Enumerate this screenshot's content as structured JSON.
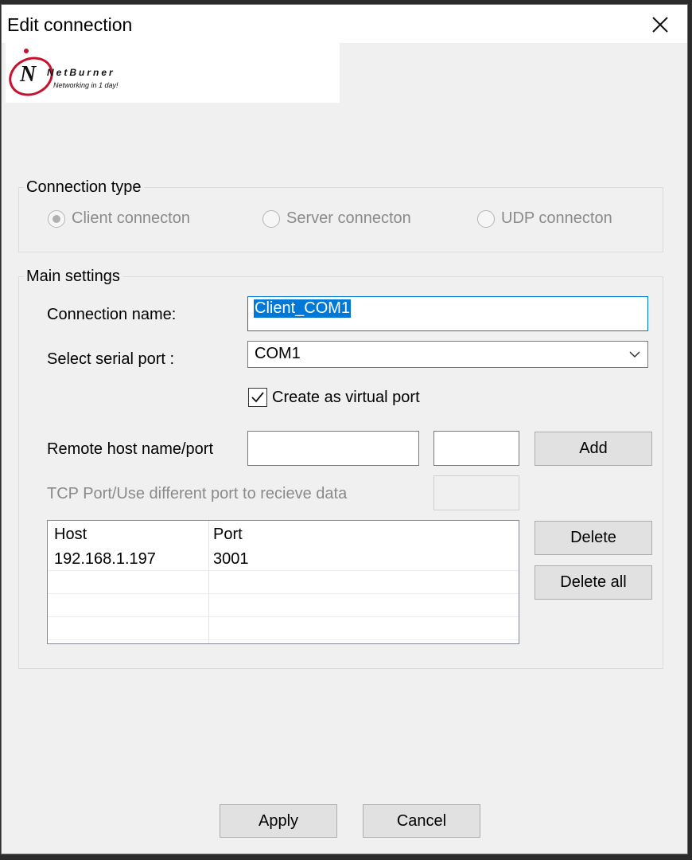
{
  "window": {
    "title": "Edit connection"
  },
  "logo": {
    "brand": "NetBurner",
    "tagline": "Networking in 1 day!"
  },
  "connection_type": {
    "legend": "Connection type",
    "options": [
      {
        "label": "Client connecton",
        "selected": true
      },
      {
        "label": "Server connecton",
        "selected": false
      },
      {
        "label": "UDP connecton",
        "selected": false
      }
    ]
  },
  "main_settings": {
    "legend": "Main settings",
    "connection_name_label": "Connection name:",
    "connection_name_value": "Client_COM1",
    "serial_port_label": "Select serial port :",
    "serial_port_value": "COM1",
    "virtual_port_label": "Create as virtual port",
    "virtual_port_checked": true,
    "remote_host_label": "Remote host name/port",
    "remote_host_value": "",
    "remote_port_value": "",
    "add_label": "Add",
    "tcp_port_label": "TCP Port/Use different port to recieve data",
    "tcp_port_value": "",
    "table": {
      "columns": [
        "Host",
        "Port"
      ],
      "rows": [
        {
          "host": "192.168.1.197",
          "port": "3001"
        }
      ]
    },
    "delete_label": "Delete",
    "delete_all_label": "Delete all"
  },
  "footer": {
    "apply_label": "Apply",
    "cancel_label": "Cancel"
  }
}
